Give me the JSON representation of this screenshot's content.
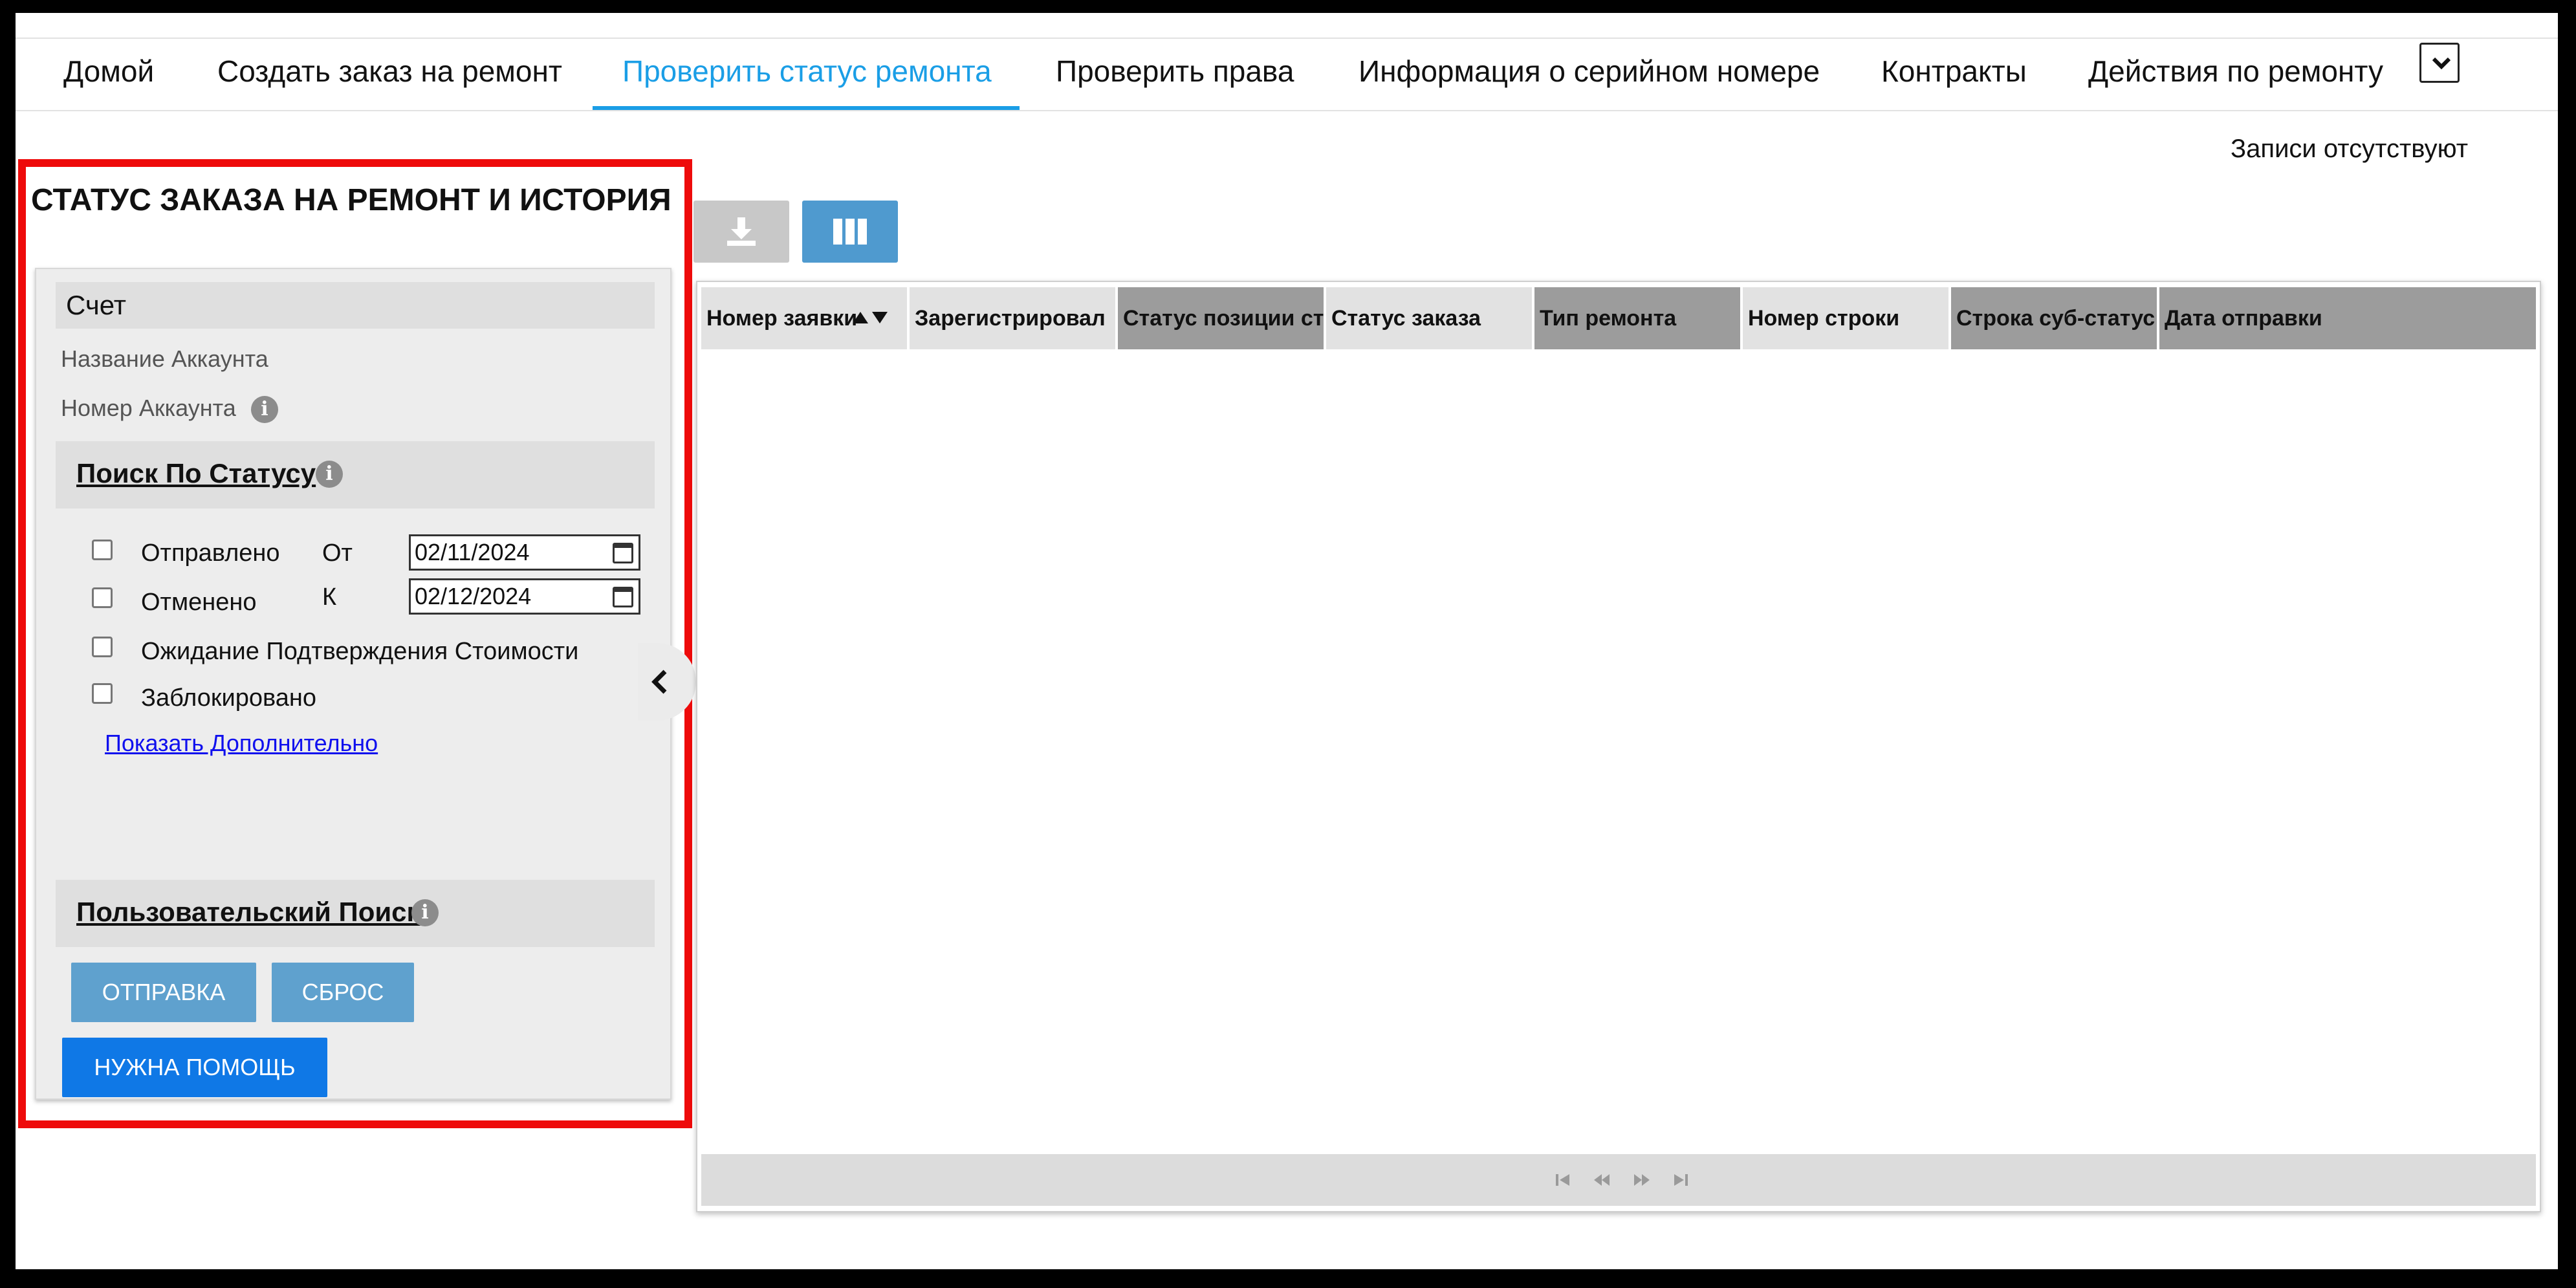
{
  "nav": {
    "tabs": [
      {
        "label": "Домой"
      },
      {
        "label": "Создать заказ на ремонт"
      },
      {
        "label": "Проверить статус ремонта"
      },
      {
        "label": "Проверить права"
      },
      {
        "label": "Информация о серийном номере"
      },
      {
        "label": "Контракты"
      },
      {
        "label": "Действия по ремонту"
      }
    ],
    "active_tab": "Проверить статус ремонта",
    "more_icon": "chevron-down-icon"
  },
  "records_status": "Записи отсутствуют",
  "panel": {
    "title": "СТАТУС ЗАКАЗА НА РЕМОНТ И ИСТОРИЯ",
    "account": {
      "header": "Счет",
      "name_label": "Название Аккаунта",
      "number_label": "Номер Аккаунта"
    },
    "status_search": {
      "title": "Поиск По Статусу",
      "checkboxes": [
        {
          "label": "Отправлено",
          "checked": false
        },
        {
          "label": "Отменено",
          "checked": false
        },
        {
          "label": "Ожидание Подтверждения Стоимости",
          "checked": false
        },
        {
          "label": "Заблокировано",
          "checked": false
        }
      ],
      "from_label": "От",
      "from_value": "02/11/2024",
      "to_label": "К",
      "to_value": "02/12/2024",
      "show_more": "Показать Дополнительно"
    },
    "custom_search": {
      "title": "Пользовательский Поиск"
    },
    "submit_label": "ОТПРАВКА",
    "reset_label": "СБРОС",
    "help_label": "НУЖНА ПОМОЩЬ"
  },
  "grid": {
    "columns": [
      {
        "label": "Номер заявки",
        "sort": "asc/desc"
      },
      {
        "label": "Зарегистрировал"
      },
      {
        "label": "Статус позиции ст"
      },
      {
        "label": "Статус заказа"
      },
      {
        "label": "Тип ремонта"
      },
      {
        "label": "Номер строки"
      },
      {
        "label": "Строка суб-статус"
      },
      {
        "label": "Дата отправки"
      }
    ],
    "rows": []
  },
  "colors": {
    "accent": "#1a9ee6",
    "highlight_border": "#ee0b0b",
    "button": "#5fa1ce",
    "help_button": "#0f78e6"
  }
}
